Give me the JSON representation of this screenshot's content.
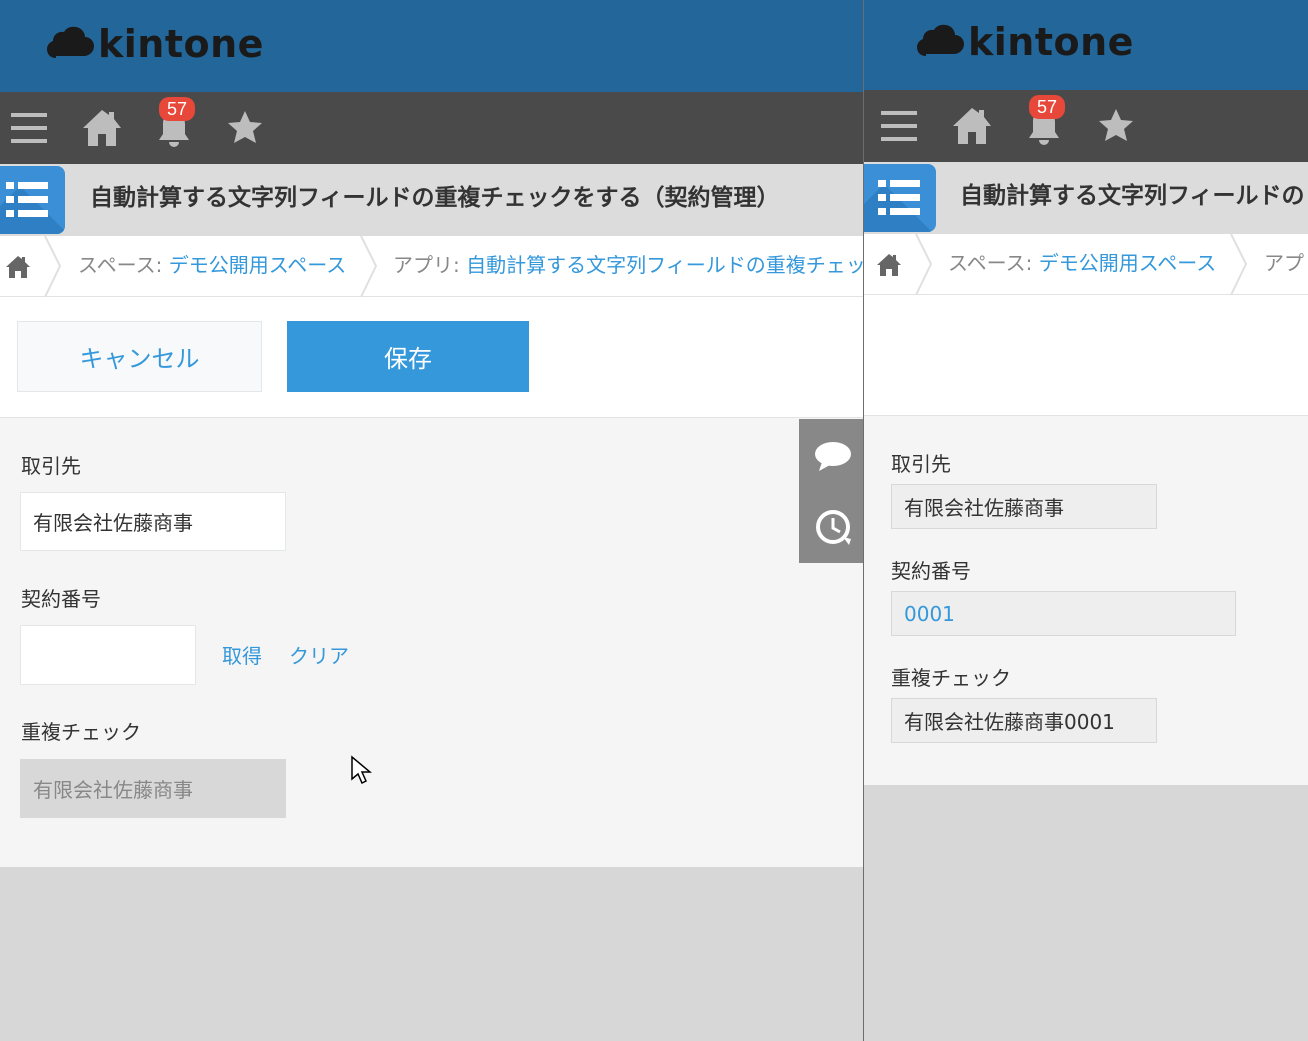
{
  "brand": {
    "name": "kintone"
  },
  "nav": {
    "notification_count": "57"
  },
  "app": {
    "title": "自動計算する文字列フィールドの重複チェックをする（契約管理）",
    "title_truncated": "自動計算する文字列フィールドの"
  },
  "breadcrumb": {
    "space_prefix": "スペース: ",
    "space_name": "デモ公開用スペース",
    "app_prefix": "アプリ: ",
    "app_name": "自動計算する文字列フィールドの重複チェック",
    "app_prefix_truncated": "アプリ"
  },
  "actions": {
    "cancel_label": "キャンセル",
    "save_label": "保存"
  },
  "edit_form": {
    "client_label": "取引先",
    "client_value": "有限会社佐藤商事",
    "contract_label": "契約番号",
    "contract_value": "",
    "get_link": "取得",
    "clear_link": "クリア",
    "dup_label": "重複チェック",
    "dup_value": "有限会社佐藤商事"
  },
  "view_form": {
    "client_label": "取引先",
    "client_value": "有限会社佐藤商事",
    "contract_label": "契約番号",
    "contract_value": "0001",
    "dup_label": "重複チェック",
    "dup_value": "有限会社佐藤商事0001"
  },
  "colors": {
    "header": "#23679a",
    "navbar": "#4a4a4a",
    "accent": "#3498db",
    "badge": "#e8483a",
    "titlebar": "#dcdcdc",
    "background": "#d6d7d6"
  }
}
